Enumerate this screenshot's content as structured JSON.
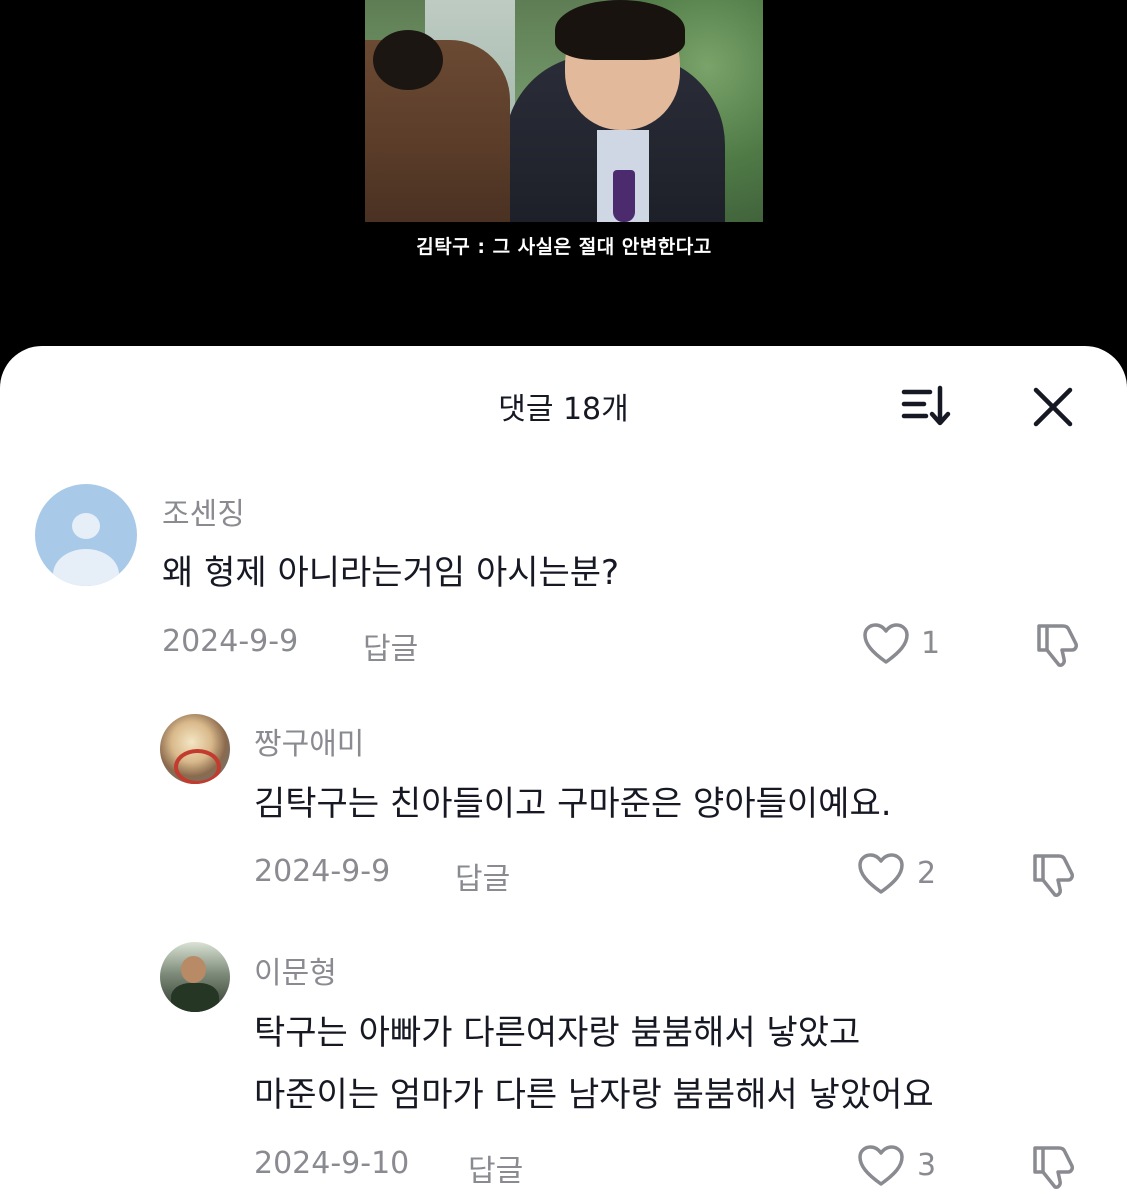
{
  "video": {
    "subtitle": "김탁구 : 그 사실은 절대 안변한다고"
  },
  "sheet": {
    "title": "댓글 18개",
    "sort_icon": "sort-icon",
    "close_icon": "close-icon"
  },
  "comments": [
    {
      "username": "조센징",
      "text": "왜 형제 아니라는거임 아시는분?",
      "date": "2024-9-9",
      "reply_label": "답글",
      "likes": "1",
      "avatar": "default-avatar"
    },
    {
      "username": "짱구애미",
      "text": "김탁구는 친아들이고 구마준은 양아들이예요.",
      "date": "2024-9-9",
      "reply_label": "답글",
      "likes": "2",
      "avatar": "cartoon-avatar"
    },
    {
      "username": "이문형",
      "text_line1": "탁구는 아빠가 다른여자랑 붐붐해서 낳았고",
      "text_line2": "마준이는 엄마가 다른 남자랑 붐붐해서 낳았어요",
      "date": "2024-9-10",
      "reply_label": "답글",
      "likes": "3",
      "avatar": "photo-avatar"
    }
  ]
}
